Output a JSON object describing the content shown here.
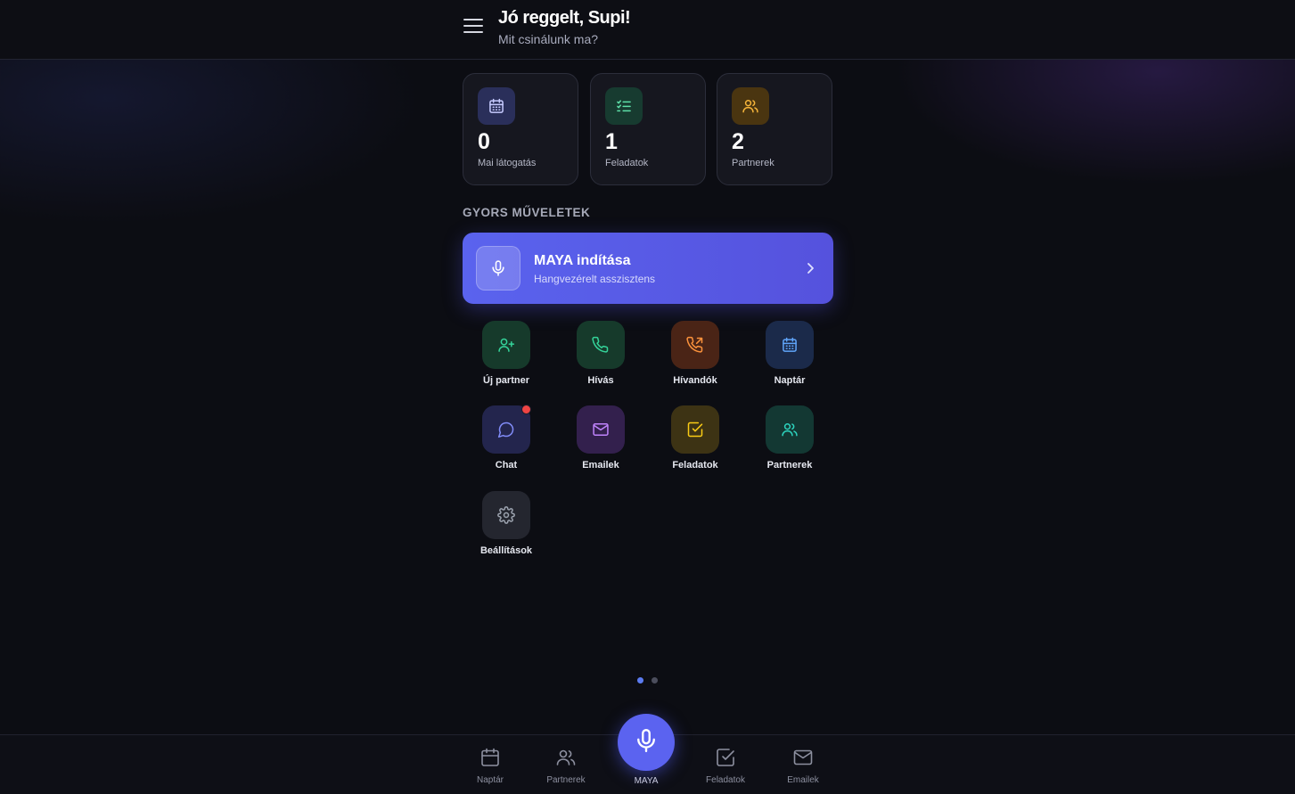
{
  "header": {
    "title": "Jó reggelt, Supi!",
    "subtitle": "Mit csinálunk ma?"
  },
  "stats": [
    {
      "value": "0",
      "label": "Mai látogatás",
      "icon": "calendar-icon",
      "color": "#8a8ff5"
    },
    {
      "value": "1",
      "label": "Feladatok",
      "icon": "checklist-icon",
      "color": "#34d399"
    },
    {
      "value": "2",
      "label": "Partnerek",
      "icon": "users-icon",
      "color": "#f5b43a"
    }
  ],
  "quick_actions": {
    "title": "GYORS MŰVELETEK",
    "maya": {
      "title": "MAYA indítása",
      "subtitle": "Hangvezérelt asszisztens"
    },
    "items": [
      {
        "label": "Új partner",
        "icon": "user-plus-icon",
        "color": "#34d399"
      },
      {
        "label": "Hívás",
        "icon": "phone-icon",
        "color": "#34d399"
      },
      {
        "label": "Hívandók",
        "icon": "phone-outgoing-icon",
        "color": "#fb923c"
      },
      {
        "label": "Naptár",
        "icon": "calendar-icon",
        "color": "#60a5fa"
      },
      {
        "label": "Chat",
        "icon": "chat-bubble-icon",
        "color": "#818cf8",
        "badge": true
      },
      {
        "label": "Emailek",
        "icon": "mail-icon",
        "color": "#c084fc"
      },
      {
        "label": "Feladatok",
        "icon": "checkbox-icon",
        "color": "#facc15"
      },
      {
        "label": "Partnerek",
        "icon": "users-icon",
        "color": "#2dd4bf"
      },
      {
        "label": "Beállítások",
        "icon": "gear-icon",
        "color": "#9ca3af"
      }
    ]
  },
  "pagination": {
    "pages": 2,
    "current": 1
  },
  "bottom_nav": {
    "items": [
      {
        "label": "Naptár",
        "icon": "calendar-icon"
      },
      {
        "label": "Partnerek",
        "icon": "users-icon"
      },
      {
        "label": "Feladatok",
        "icon": "checkbox-icon"
      },
      {
        "label": "Emailek",
        "icon": "mail-icon"
      }
    ],
    "center": {
      "label": "MAYA",
      "icon": "microphone-icon"
    }
  },
  "colors": {
    "accent": "#5b63f0",
    "background": "#0c0d13",
    "badge": "#ef4444"
  }
}
